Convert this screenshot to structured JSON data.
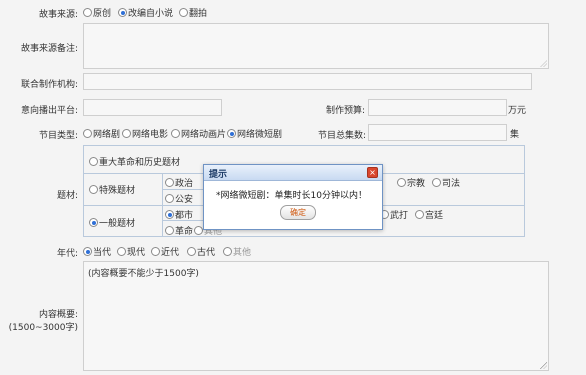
{
  "story_source": {
    "label": "故事来源:",
    "options": [
      {
        "text": "原创",
        "selected": false
      },
      {
        "text": "改编自小说",
        "selected": true
      },
      {
        "text": "翻拍",
        "selected": false
      }
    ]
  },
  "story_source_note": {
    "label": "故事来源备注:"
  },
  "co_producer": {
    "label": "联合制作机构:"
  },
  "platform": {
    "label": "意向播出平台:"
  },
  "budget": {
    "label": "制作预算:",
    "unit": "万元"
  },
  "program_type": {
    "label": "节目类型:",
    "options": [
      {
        "text": "网络剧",
        "selected": false
      },
      {
        "text": "网络电影",
        "selected": false
      },
      {
        "text": "网络动画片",
        "selected": false
      },
      {
        "text": "网络微短剧",
        "selected": true
      }
    ]
  },
  "episodes": {
    "label": "节目总集数:",
    "unit": "集"
  },
  "theme": {
    "label": "题材:",
    "major": {
      "text": "重大革命和历史题材",
      "selected": false
    },
    "special": {
      "text": "特殊题材",
      "selected": false,
      "options_row1": [
        "政治",
        "宗教",
        "司法"
      ],
      "options_row2": [
        "公安"
      ]
    },
    "general": {
      "text": "一般题材",
      "selected": true,
      "options_row1": [
        {
          "text": "都市",
          "selected": true
        },
        {
          "text": "武打",
          "selected": false
        },
        {
          "text": "宫廷",
          "selected": false
        }
      ],
      "options_row2": [
        "革命",
        "其他"
      ]
    }
  },
  "era": {
    "label": "年代:",
    "options": [
      {
        "text": "当代",
        "selected": true
      },
      {
        "text": "现代",
        "selected": false
      },
      {
        "text": "近代",
        "selected": false
      },
      {
        "text": "古代",
        "selected": false
      },
      {
        "text": "其他",
        "selected": false
      }
    ]
  },
  "summary": {
    "label": "内容概要:",
    "sublabel": "(1500~3000字)",
    "hint": "(内容概要不能少于1500字)"
  },
  "dialog": {
    "title": "提示",
    "close": "×",
    "message": "*网络微短剧：单集时长10分钟以内！",
    "ok_label": "确定"
  },
  "colors": {
    "accent": "#2f6fd6",
    "dialog_border": "#6f93c4",
    "close_red": "#d9472f"
  }
}
